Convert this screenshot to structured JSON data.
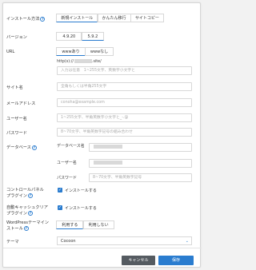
{
  "install_method": {
    "label": "インストール方法",
    "tabs": [
      "新規インストール",
      "かんたん移行",
      "サイトコピー"
    ],
    "active": 0
  },
  "version": {
    "label": "バージョン",
    "tabs": [
      "4.9.20",
      "5.9.2"
    ],
    "active": 1
  },
  "url": {
    "label": "URL",
    "tabs": [
      "wwwあり",
      "wwwなし"
    ],
    "active": 0,
    "prefix": "http(s)://",
    "suffix": ".site/",
    "placeholder": "入力は任意　1~255文字、英数字小文字と"
  },
  "site_name": {
    "label": "サイト名",
    "placeholder": "全角もしくは半角255文字"
  },
  "email": {
    "label": "メールアドレス",
    "placeholder": "conoha@example.com"
  },
  "username": {
    "label": "ユーザー名",
    "placeholder": "1~255文字、半角英数字小文字と_-.@"
  },
  "password": {
    "label": "パスワード",
    "placeholder": "8~70文字、半角英数字記号の組み合わせ"
  },
  "database": {
    "label": "データベース",
    "db_name_label": "データベース名",
    "db_user_label": "ユーザー名",
    "db_password_label": "パスワード",
    "db_password_placeholder": "8~70文字、半角英数字記号"
  },
  "control_panel_plugin": {
    "label_line1": "コントロールパネル",
    "label_line2": "プラグイン",
    "checkbox_label": "インストールする"
  },
  "auto_cache_plugin": {
    "label_line1": "自動キャッシュクリア",
    "label_line2": "プラグイン",
    "checkbox_label": "インストールする"
  },
  "theme_install": {
    "label_line1": "WordPressテーマイン",
    "label_line2": "ストール",
    "tabs": [
      "利用する",
      "利用しない"
    ],
    "active": 0
  },
  "theme": {
    "label": "テーマ",
    "value": "Cocoon"
  },
  "buttons": {
    "cancel": "キャンセル",
    "save": "保存"
  },
  "colors": {
    "accent": "#2a7ccf",
    "cancel_bg": "#555b61"
  }
}
